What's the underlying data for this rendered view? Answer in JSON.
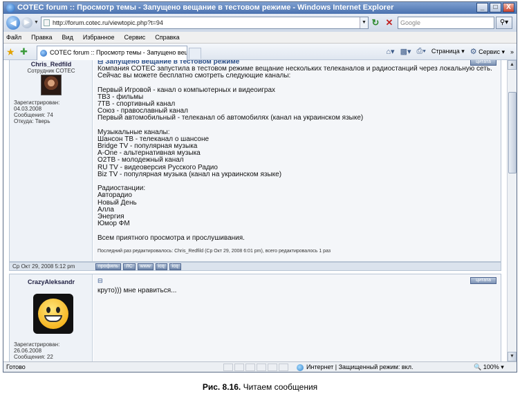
{
  "window": {
    "title": "COTEC forum :: Просмотр темы - Запущено вещание в тестовом режиме - Windows Internet Explorer",
    "min_label": "_",
    "max_label": "□",
    "close_label": "X"
  },
  "address_bar": {
    "url": "http://forum.cotec.ru/viewtopic.php?t=94",
    "search_placeholder": "Google",
    "search_icon": "magnifier-icon"
  },
  "menu": [
    "Файл",
    "Правка",
    "Вид",
    "Избранное",
    "Сервис",
    "Справка"
  ],
  "tab": {
    "label": "COTEC forum :: Просмотр темы - Запущено вещани..."
  },
  "commands": {
    "page_label": "Страница",
    "tools_label": "Сервис"
  },
  "post1": {
    "author": "Chris_Redfild",
    "rank": "Сотрудник COTEC",
    "info": [
      "Зарегистрирован:",
      "04.03.2008",
      "Сообщения: 74",
      "Откуда: Тверь"
    ],
    "title": "Запущено вещание в тестовом режиме",
    "quote_label": "цитата",
    "lines": [
      "Компания COTEC запустила в тестовом режиме вещание нескольких телеканалов и радиостанций через локальную сеть.",
      "Сейчас вы можете бесплатно смотреть следующие каналы:",
      "",
      "Первый Игровой - канал о компьютерных и видеоиграх",
      "ТВ3 - фильмы",
      "7ТВ - спортивный канал",
      "Союз - православный канал",
      "Первый автомобильный - телеканал об автомобилях (канал на украинском языке)",
      "",
      "Музыкальные каналы:",
      "Шансон ТВ - телеканал о шансоне",
      "Bridge TV - популярная музыка",
      "A-One - альтернативная музыка",
      "O2ТВ - молодежный канал",
      "RU TV - видеоверсия Русского Радио",
      "Biz TV - популярная музыка (канал на украинском языке)",
      "",
      "Радиостанции:",
      "Авторадио",
      "Новый День",
      "Алла",
      "Энергия",
      "Юмор ФМ",
      "",
      "Всем приятного просмотра и прослушивания."
    ],
    "edited": "Последний раз редактировалось: Chris_Redfild (Ср Окт 29, 2008 6:01 pm), всего редактировалось 1 раз",
    "date": "Ср Окт 29, 2008 5:12 pm",
    "buttons": [
      "профиль",
      "ЛС",
      "www",
      "icq",
      "icq"
    ]
  },
  "post2": {
    "author": "CrazyAleksandr",
    "info": [
      "Зарегистрирован:",
      "26.06.2008",
      "Сообщения: 22"
    ],
    "title_icon": "⊟",
    "quote_label": "цитата",
    "text": "круто))) мне нравиться..."
  },
  "status": {
    "text": "Готово",
    "zone": "Интернет | Защищенный режим: вкл.",
    "zoom": "100%"
  },
  "caption": {
    "label": "Рис. 8.16.",
    "text": "Читаем сообщения"
  }
}
